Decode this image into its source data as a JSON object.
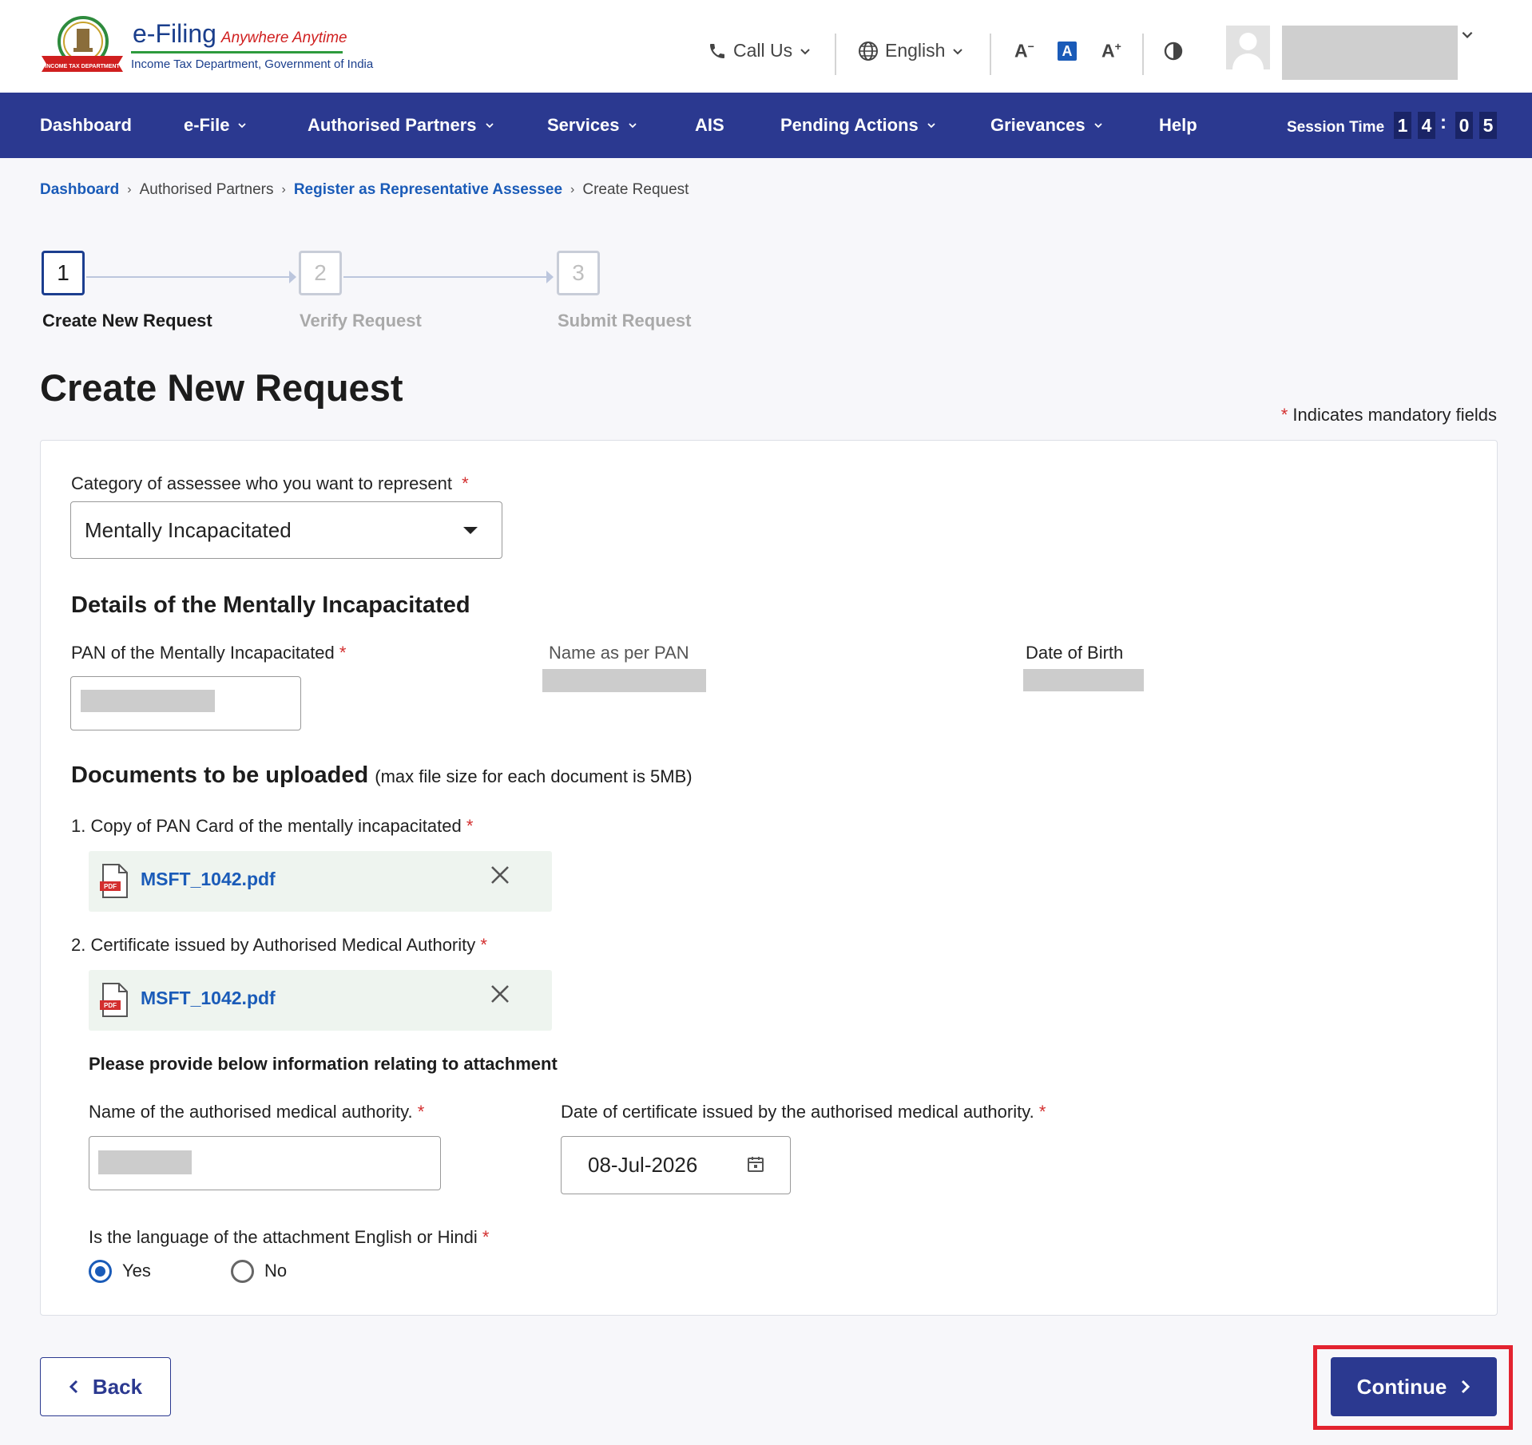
{
  "brand": {
    "title": "e-Filing",
    "tagline": "Anywhere Anytime",
    "subtitle": "Income Tax Department, Government of India",
    "emblem_ribbon": "INCOME TAX DEPARTMENT"
  },
  "toolbar": {
    "call_us": "Call Us",
    "language": "English",
    "font_decrease": "A",
    "font_normal": "A",
    "font_increase": "A"
  },
  "nav": {
    "items": [
      {
        "label": "Dashboard"
      },
      {
        "label": "e-File"
      },
      {
        "label": "Authorised Partners"
      },
      {
        "label": "Services"
      },
      {
        "label": "AIS"
      },
      {
        "label": "Pending Actions"
      },
      {
        "label": "Grievances"
      },
      {
        "label": "Help"
      }
    ],
    "session_label": "Session Time",
    "session_digits": [
      "1",
      "4",
      "0",
      "5"
    ],
    "session_separator": ":"
  },
  "breadcrumb": [
    {
      "label": "Dashboard"
    },
    {
      "label": "Authorised Partners"
    },
    {
      "label": "Register as Representative Assessee"
    },
    {
      "label": "Create Request"
    }
  ],
  "stepper": [
    {
      "number": "1",
      "label": "Create New Request"
    },
    {
      "number": "2",
      "label": "Verify Request"
    },
    {
      "number": "3",
      "label": "Submit Request"
    }
  ],
  "page": {
    "title": "Create New Request",
    "mandatory_note": "Indicates mandatory fields",
    "required_mark": "*"
  },
  "form": {
    "category_label": "Category of assessee who you want to represent",
    "category_value": "Mentally Incapacitated",
    "details_heading": "Details of the Mentally Incapacitated",
    "pan_label": "PAN of the Mentally Incapacitated",
    "name_label": "Name as per PAN",
    "dob_label": "Date of Birth",
    "docs_heading": "Documents to be uploaded",
    "docs_note": "(max file size for each document is 5MB)",
    "doc1_label": "1. Copy of PAN Card of the mentally incapacitated",
    "doc1_file": "MSFT_1042.pdf",
    "doc2_label": "2. Certificate issued by Authorised Medical Authority",
    "doc2_file": "MSFT_1042.pdf",
    "pdf_badge": "PDF",
    "attachment_heading": "Please provide below information relating to attachment",
    "authority_label": "Name of the authorised medical authority.",
    "cert_date_label": "Date of certificate issued by the authorised medical authority.",
    "cert_date_value": "08-Jul-2026",
    "language_question": "Is the language of the attachment English or Hindi",
    "language_options": [
      {
        "label": "Yes",
        "selected": true
      },
      {
        "label": "No",
        "selected": false
      }
    ]
  },
  "actions": {
    "back_label": "Back",
    "continue_label": "Continue"
  },
  "colors": {
    "nav_bg": "#2b3990",
    "link": "#1a5bb8",
    "required": "#d32f2f",
    "highlight": "#e3232f"
  }
}
